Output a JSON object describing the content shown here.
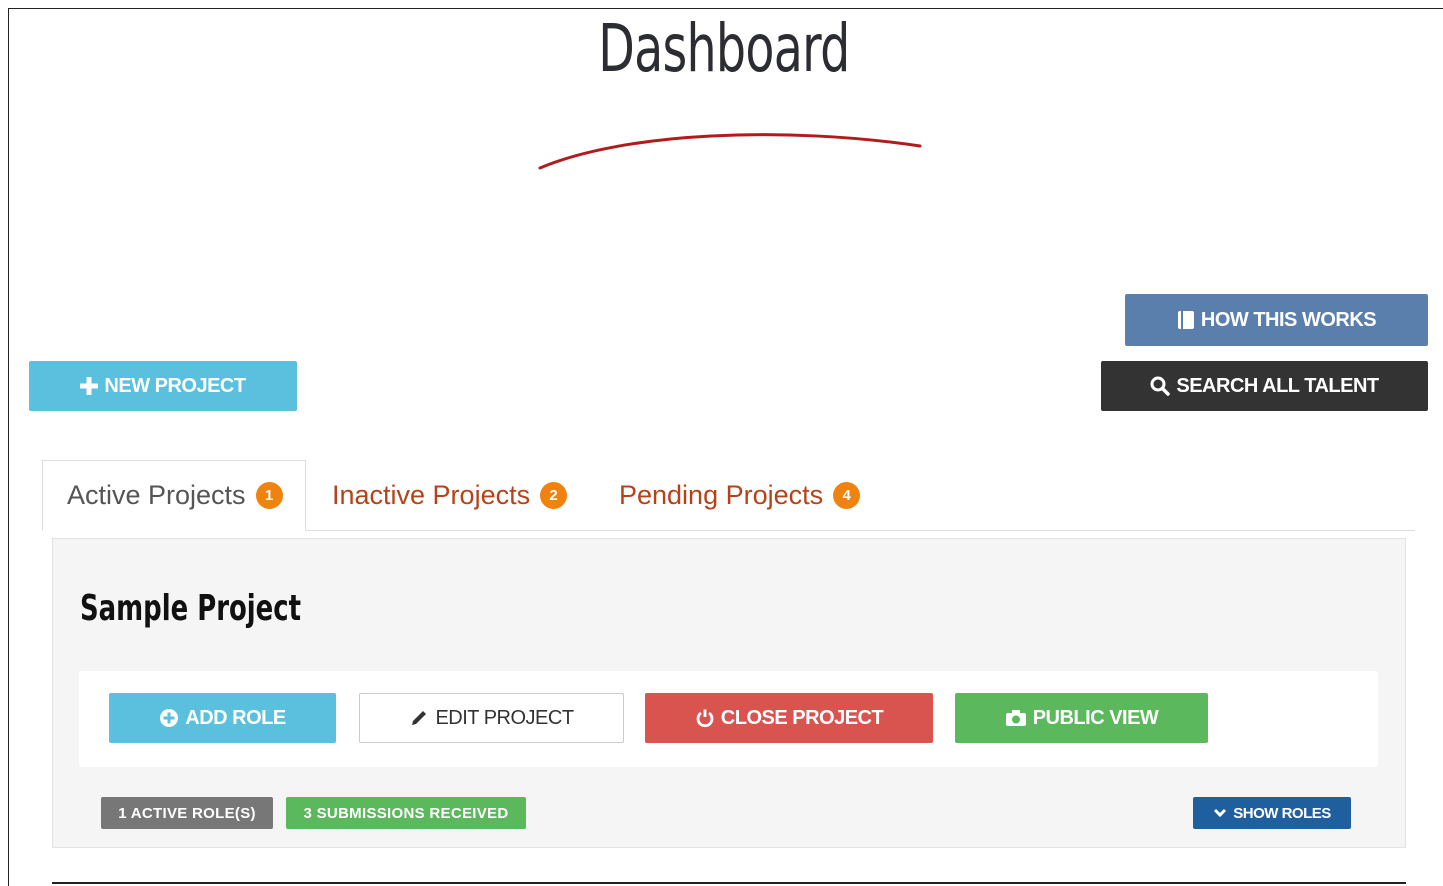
{
  "page": {
    "title": "Dashboard"
  },
  "header_buttons": {
    "how_it_works": "HOW THIS WORKS",
    "search_talent": "SEARCH ALL TALENT",
    "new_project": "NEW PROJECT"
  },
  "tabs": [
    {
      "label": "Active Projects",
      "count": "1",
      "active": true
    },
    {
      "label": "Inactive Projects",
      "count": "2",
      "active": false
    },
    {
      "label": "Pending Projects",
      "count": "4",
      "active": false
    }
  ],
  "project": {
    "title": "Sample Project",
    "actions": {
      "add_role": "ADD ROLE",
      "edit_project": "EDIT PROJECT",
      "close_project": "CLOSE PROJECT",
      "public_view": "PUBLIC VIEW"
    },
    "labels": {
      "active_roles": "1 ACTIVE ROLE(S)",
      "submissions": "3 SUBMISSIONS RECEIVED"
    },
    "show_roles": "SHOW ROLES"
  },
  "colors": {
    "info": "#5bc0de",
    "danger": "#d9534f",
    "success": "#5cb85c",
    "primary_dark": "#1f5f9e",
    "tab_link": "#b5431a",
    "badge": "#f0820f"
  },
  "icons": {
    "how_it_works": "book-icon",
    "search_talent": "search-icon",
    "new_project": "plus-icon",
    "add_role": "plus-circle-icon",
    "edit_project": "pencil-icon",
    "close_project": "power-icon",
    "public_view": "camera-icon",
    "show_roles": "chevron-down-icon"
  }
}
